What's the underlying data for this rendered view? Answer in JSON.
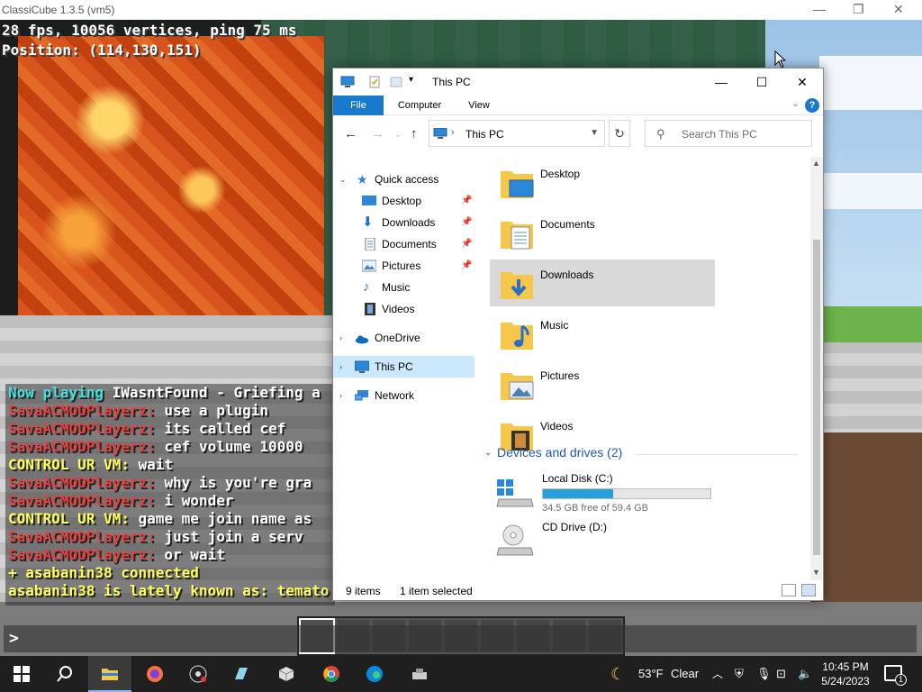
{
  "game": {
    "window_title": "ClassiCube 1.3.5 (vm5)",
    "hud_line1": "28 fps, 10056 vertices, ping 75 ms",
    "hud_line2": "Position: (114,130,151)",
    "chat": [
      {
        "prefix": "Now playing",
        "text": " IWasntFound - Griefing a",
        "prefix_color": "cyan",
        "text_color": "white"
      },
      {
        "prefix": "SavaACMODPlayerz:",
        "text": " use a plugin",
        "prefix_color": "red",
        "text_color": "white"
      },
      {
        "prefix": "SavaACMODPlayerz:",
        "text": " its called cef",
        "prefix_color": "red",
        "text_color": "white"
      },
      {
        "prefix": "SavaACMODPlayerz:",
        "text": " cef volume 10000",
        "prefix_color": "red",
        "text_color": "white"
      },
      {
        "prefix": "CONTROL UR VM:",
        "text": " wait",
        "prefix_color": "yellow",
        "text_color": "white"
      },
      {
        "prefix": "SavaACMODPlayerz:",
        "text": " why is you're gra",
        "prefix_color": "red",
        "text_color": "white"
      },
      {
        "prefix": "SavaACMODPlayerz:",
        "text": " i wonder",
        "prefix_color": "red",
        "text_color": "white"
      },
      {
        "prefix": "CONTROL UR VM:",
        "text": " game me join name as",
        "prefix_color": "yellow",
        "text_color": "white"
      },
      {
        "prefix": "SavaACMODPlayerz:",
        "text": " just join a serv",
        "prefix_color": "red",
        "text_color": "white"
      },
      {
        "prefix": "SavaACMODPlayerz:",
        "text": " or wait",
        "prefix_color": "red",
        "text_color": "white"
      },
      {
        "prefix": "",
        "text": "+ asabanin38 connected",
        "prefix_color": "yellow",
        "text_color": "yellow"
      },
      {
        "prefix": "",
        "text": "asabanin38 is lately known as: temato",
        "prefix_color": "yellow",
        "text_color": "yellow"
      }
    ],
    "chat_prompt": ">"
  },
  "explorer": {
    "title": "This PC",
    "tabs": {
      "file": "File",
      "computer": "Computer",
      "view": "View"
    },
    "help": "?",
    "address": "This PC",
    "search_placeholder": "Search This PC",
    "nav": {
      "quick_access": "Quick access",
      "desktop": "Desktop",
      "downloads": "Downloads",
      "documents": "Documents",
      "pictures": "Pictures",
      "music": "Music",
      "videos": "Videos",
      "onedrive": "OneDrive",
      "this_pc": "This PC",
      "network": "Network"
    },
    "folders": [
      "Desktop",
      "Documents",
      "Downloads",
      "Music",
      "Pictures",
      "Videos"
    ],
    "devices_header": "Devices and drives (2)",
    "drives": {
      "c_name": "Local Disk (C:)",
      "c_free": "34.5 GB free of 59.4 GB",
      "c_used_fraction": 0.42,
      "d_name": "CD Drive (D:)"
    },
    "status": {
      "items": "9 items",
      "selected": "1 item selected"
    }
  },
  "taskbar": {
    "weather_temp": "53°F",
    "weather_text": "Clear",
    "time": "10:45 PM",
    "date": "5/24/2023",
    "notifications": "1"
  },
  "colors": {
    "accent": "#1979ca",
    "selection": "#cce8ff",
    "drive_bar": "#26a0da",
    "mc_red": "#e0413f",
    "mc_yellow": "#ffff55",
    "mc_cyan": "#3fe0e0"
  }
}
